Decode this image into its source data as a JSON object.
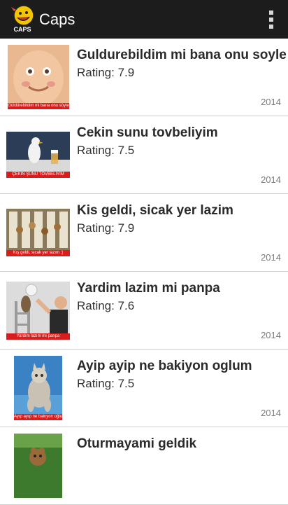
{
  "app": {
    "title": "Caps",
    "logo_text": "CAPS"
  },
  "icons": {
    "menu": "overflow-menu-icon"
  },
  "items": [
    {
      "title": "Guldurebildim mi bana onu soyle",
      "rating": "Rating: 7.9",
      "year": "2014",
      "caption": "Güldürebildim mi bana onu söyle"
    },
    {
      "title": "Cekin sunu tovbeliyim",
      "rating": "Rating: 7.5",
      "year": "2014",
      "caption": "ÇEKİN ŞUNU TÖVBELİYİM"
    },
    {
      "title": "Kis geldi, sicak yer lazim",
      "rating": "Rating: 7.9",
      "year": "2014",
      "caption": "Kış geldi, sıcak yer lazım :)"
    },
    {
      "title": "Yardim lazim mi panpa",
      "rating": "Rating: 7.6",
      "year": "2014",
      "caption": "Yardım lazım mı panpa"
    },
    {
      "title": "Ayip ayip ne bakiyon oglum",
      "rating": "Rating: 7.5",
      "year": "2014",
      "caption": "Ayıp ayıp ne bakıyon oğlum"
    },
    {
      "title": "Oturmayami geldik",
      "rating": "",
      "year": "",
      "caption": ""
    }
  ]
}
